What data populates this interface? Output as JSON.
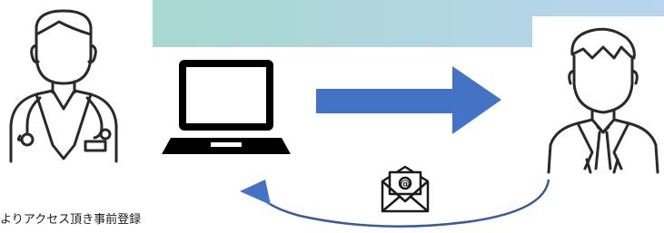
{
  "colors": {
    "banner_left": "#a8d8d0",
    "banner_right": "#b8d4ee",
    "arrow_fill": "#4472c4",
    "return_arrow": "#3b5a9a",
    "outline": "#2a2a2a",
    "laptop": "#000000"
  },
  "icons": {
    "doctor": "doctor-icon",
    "laptop": "laptop-icon",
    "patient": "businessman-icon",
    "email": "email-envelope-icon",
    "forward_arrow": "right-arrow-icon",
    "return_arrow": "curved-return-arrow-icon"
  },
  "caption": "よりアクセス頂き事前登録"
}
